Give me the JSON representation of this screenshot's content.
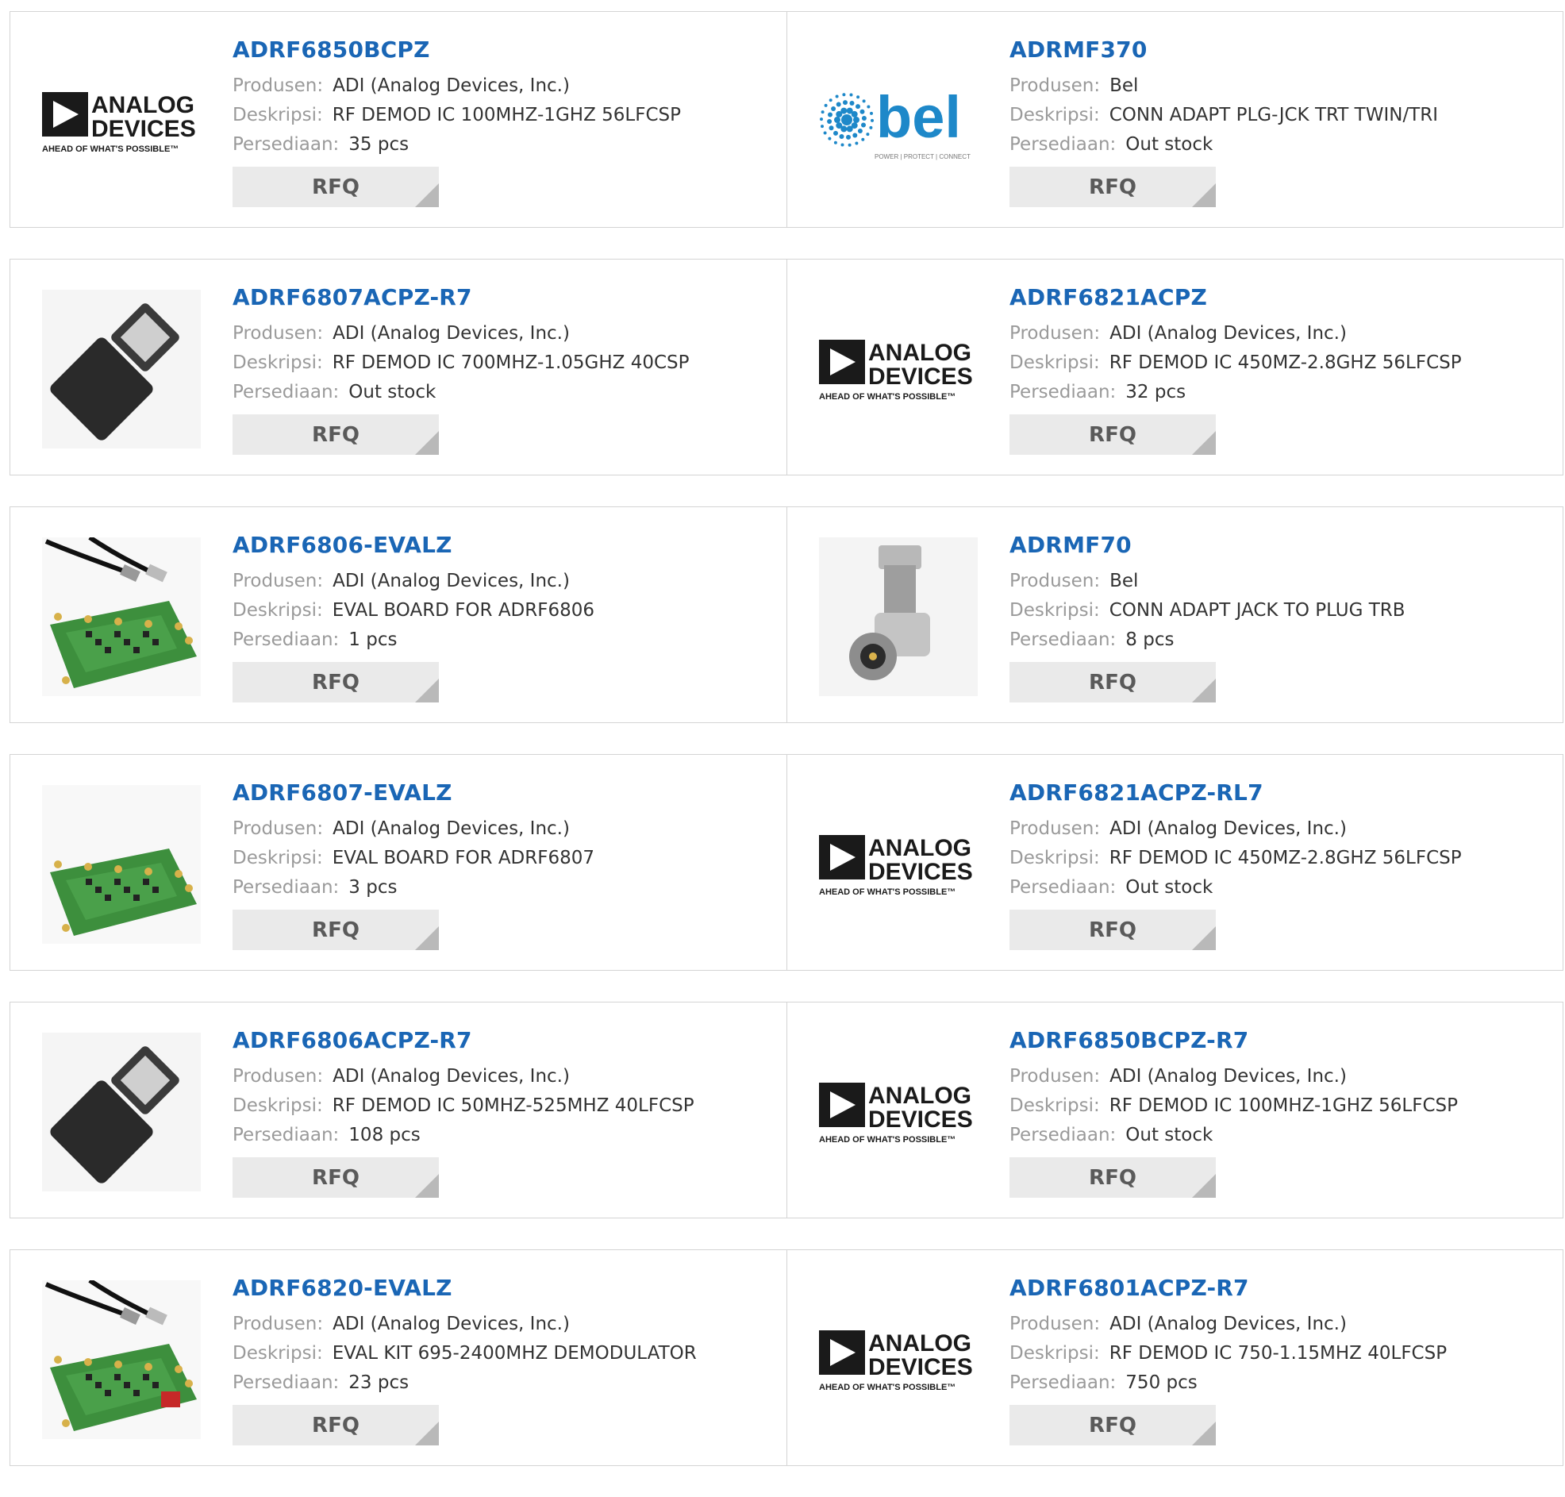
{
  "labels": {
    "manufacturer": "Produsen:",
    "description": "Deskripsi:",
    "stock": "Persediaan:",
    "rfq": "RFQ"
  },
  "brand_logos": {
    "analog": {
      "line1": "ANALOG",
      "line2": "DEVICES",
      "tagline": "AHEAD OF WHAT'S POSSIBLE™"
    },
    "bel": {
      "name": "bel",
      "tagline": "POWER | PROTECT | CONNECT"
    }
  },
  "colors": {
    "link": "#1a66b5",
    "label": "#9a9a9a",
    "button_bg": "#eaeaea",
    "border": "#d4d4d4",
    "bel_blue": "#1e88c9"
  },
  "products": [
    {
      "pn": "ADRF6850BCPZ",
      "manufacturer": "ADI (Analog Devices, Inc.)",
      "description": "RF DEMOD IC 100MHZ-1GHZ 56LFCSP",
      "stock": "35 pcs",
      "image": "analog-devices-logo"
    },
    {
      "pn": "ADRMF370",
      "manufacturer": "Bel",
      "description": "CONN ADAPT PLG-JCK TRT TWIN/TRI",
      "stock": "Out stock",
      "image": "bel-logo"
    },
    {
      "pn": "ADRF6807ACPZ-R7",
      "manufacturer": "ADI (Analog Devices, Inc.)",
      "description": "RF DEMOD IC 700MHZ-1.05GHZ 40CSP",
      "stock": "Out stock",
      "image": "chip-package"
    },
    {
      "pn": "ADRF6821ACPZ",
      "manufacturer": "ADI (Analog Devices, Inc.)",
      "description": "RF DEMOD IC 450MZ-2.8GHZ 56LFCSP",
      "stock": "32 pcs",
      "image": "analog-devices-logo"
    },
    {
      "pn": "ADRF6806-EVALZ",
      "manufacturer": "ADI (Analog Devices, Inc.)",
      "description": "EVAL BOARD FOR ADRF6806",
      "stock": "1 pcs",
      "image": "eval-board-cable"
    },
    {
      "pn": "ADRMF70",
      "manufacturer": "Bel",
      "description": "CONN ADAPT JACK TO PLUG TRB",
      "stock": "8 pcs",
      "image": "rf-adapter"
    },
    {
      "pn": "ADRF6807-EVALZ",
      "manufacturer": "ADI (Analog Devices, Inc.)",
      "description": "EVAL BOARD FOR ADRF6807",
      "stock": "3 pcs",
      "image": "eval-board"
    },
    {
      "pn": "ADRF6821ACPZ-RL7",
      "manufacturer": "ADI (Analog Devices, Inc.)",
      "description": "RF DEMOD IC 450MZ-2.8GHZ 56LFCSP",
      "stock": "Out stock",
      "image": "analog-devices-logo"
    },
    {
      "pn": "ADRF6806ACPZ-R7",
      "manufacturer": "ADI (Analog Devices, Inc.)",
      "description": "RF DEMOD IC 50MHZ-525MHZ 40LFCSP",
      "stock": "108 pcs",
      "image": "chip-package"
    },
    {
      "pn": "ADRF6850BCPZ-R7",
      "manufacturer": "ADI (Analog Devices, Inc.)",
      "description": "RF DEMOD IC 100MHZ-1GHZ 56LFCSP",
      "stock": "Out stock",
      "image": "analog-devices-logo"
    },
    {
      "pn": "ADRF6820-EVALZ",
      "manufacturer": "ADI (Analog Devices, Inc.)",
      "description": "EVAL KIT 695-2400MHZ DEMODULATOR",
      "stock": "23 pcs",
      "image": "eval-kit-cable"
    },
    {
      "pn": "ADRF6801ACPZ-R7",
      "manufacturer": "ADI (Analog Devices, Inc.)",
      "description": "RF DEMOD IC 750-1.15MHZ 40LFCSP",
      "stock": "750 pcs",
      "image": "analog-devices-logo"
    }
  ]
}
